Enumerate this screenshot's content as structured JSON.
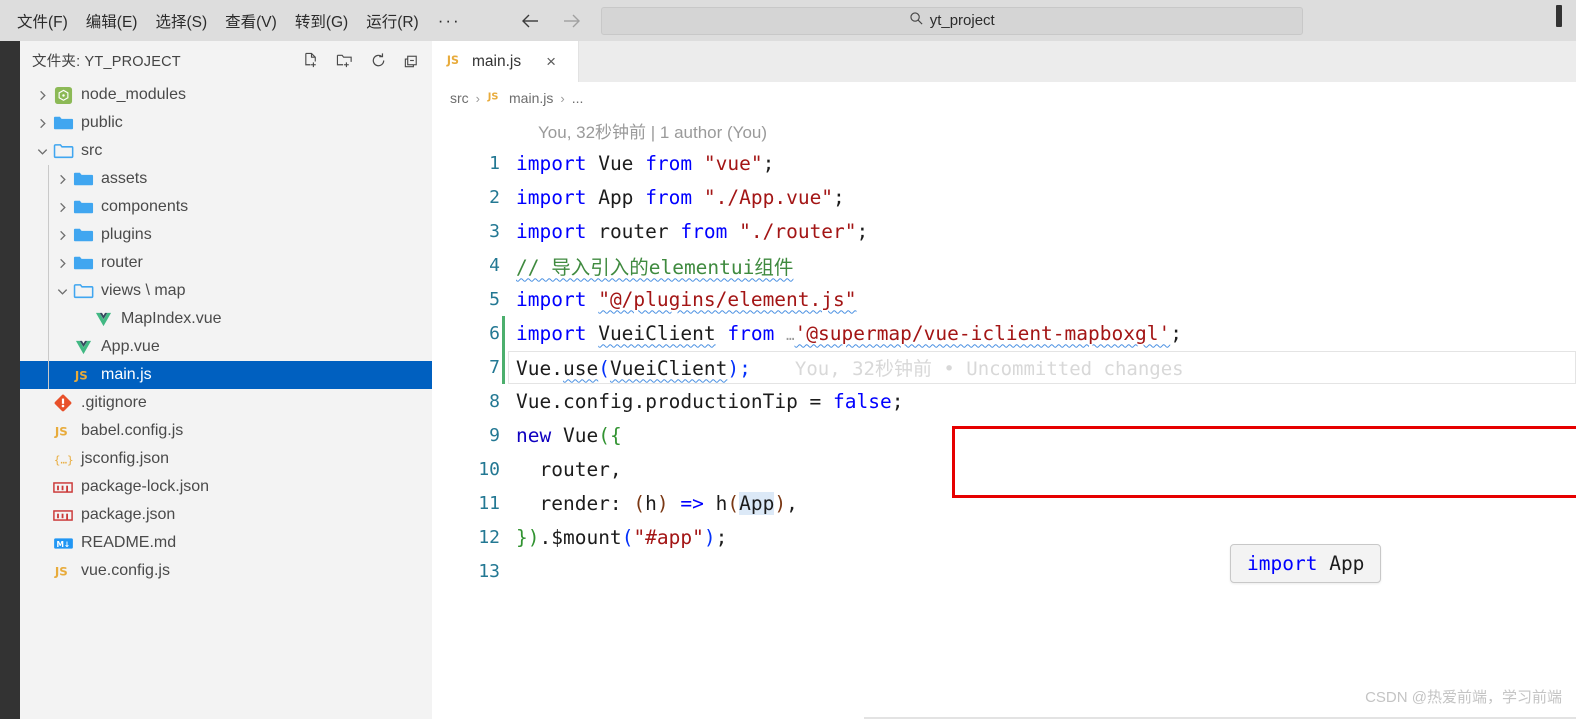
{
  "titlebar": {
    "menus": [
      "文件(F)",
      "编辑(E)",
      "选择(S)",
      "查看(V)",
      "转到(G)",
      "运行(R)"
    ],
    "more": "···",
    "back_icon": "arrow-left-icon",
    "forward_icon": "arrow-right-icon",
    "search_icon": "search-icon",
    "search_value": "yt_project"
  },
  "sidebar": {
    "header_title": "文件夹: YT_PROJECT",
    "actions": [
      {
        "name": "new-file-icon",
        "title": "新建文件"
      },
      {
        "name": "new-folder-icon",
        "title": "新建文件夹"
      },
      {
        "name": "refresh-icon",
        "title": "刷新"
      },
      {
        "name": "collapse-all-icon",
        "title": "全部折叠"
      }
    ],
    "tree": [
      {
        "label": "node_modules",
        "icon": "node-icon",
        "type": "folder",
        "depth": 0,
        "state": "collapsed",
        "selected": false
      },
      {
        "label": "public",
        "icon": "folder-icon",
        "type": "folder",
        "depth": 0,
        "state": "collapsed",
        "selected": false
      },
      {
        "label": "src",
        "icon": "folder-open-icon",
        "type": "folder",
        "depth": 0,
        "state": "expanded",
        "selected": false
      },
      {
        "label": "assets",
        "icon": "folder-icon",
        "type": "folder",
        "depth": 1,
        "state": "collapsed",
        "selected": false
      },
      {
        "label": "components",
        "icon": "folder-icon",
        "type": "folder",
        "depth": 1,
        "state": "collapsed",
        "selected": false
      },
      {
        "label": "plugins",
        "icon": "folder-icon",
        "type": "folder",
        "depth": 1,
        "state": "collapsed",
        "selected": false
      },
      {
        "label": "router",
        "icon": "folder-icon",
        "type": "folder",
        "depth": 1,
        "state": "collapsed",
        "selected": false
      },
      {
        "label": "views \\ map",
        "icon": "folder-open-icon",
        "type": "folder",
        "depth": 1,
        "state": "expanded",
        "selected": false
      },
      {
        "label": "MapIndex.vue",
        "icon": "vue-icon",
        "type": "file",
        "depth": 2,
        "state": "none",
        "selected": false
      },
      {
        "label": "App.vue",
        "icon": "vue-icon",
        "type": "file",
        "depth": 1,
        "state": "none",
        "selected": false
      },
      {
        "label": "main.js",
        "icon": "js-icon",
        "type": "file",
        "depth": 1,
        "state": "none",
        "selected": true
      },
      {
        "label": ".gitignore",
        "icon": "git-icon",
        "type": "file",
        "depth": 0,
        "state": "none",
        "selected": false
      },
      {
        "label": "babel.config.js",
        "icon": "js-icon",
        "type": "file",
        "depth": 0,
        "state": "none",
        "selected": false
      },
      {
        "label": "jsconfig.json",
        "icon": "json-icon",
        "type": "file",
        "depth": 0,
        "state": "none",
        "selected": false
      },
      {
        "label": "package-lock.json",
        "icon": "npm-icon",
        "type": "file",
        "depth": 0,
        "state": "none",
        "selected": false
      },
      {
        "label": "package.json",
        "icon": "npm-icon",
        "type": "file",
        "depth": 0,
        "state": "none",
        "selected": false
      },
      {
        "label": "README.md",
        "icon": "markdown-icon",
        "type": "file",
        "depth": 0,
        "state": "none",
        "selected": false
      },
      {
        "label": "vue.config.js",
        "icon": "js-icon",
        "type": "file",
        "depth": 0,
        "state": "none",
        "selected": false
      }
    ]
  },
  "editor": {
    "tab": {
      "icon": "js-icon",
      "name": "main.js",
      "close": "×"
    },
    "breadcrumb": [
      "src",
      "main.js",
      "..."
    ],
    "breadcrumb_sep": "›",
    "blame_header": "You, 32秒钟前 | 1 author (You)",
    "inline_blame": "You, 32秒钟前 • Uncommitted changes",
    "tooltip": {
      "keyword": "import",
      "name": "App"
    },
    "line_numbers": [
      "1",
      "2",
      "3",
      "4",
      "5",
      "6",
      "7",
      "8",
      "9",
      "10",
      "11",
      "12",
      "13"
    ],
    "code_lines": [
      "import Vue from \"vue\";",
      "import App from \"./App.vue\";",
      "import router from \"./router\";",
      "// 导入引入的elementui组件",
      "import \"@/plugins/element.js\"",
      "import VueiClient from '@supermap/vue-iclient-mapboxgl';",
      "Vue.use(VueiClient);",
      "Vue.config.productionTip = false;",
      "new Vue({",
      "  router,",
      "  render: (h) => h(App),",
      "}).$mount(\"#app\");",
      ""
    ],
    "tokens": {
      "l1": {
        "kw1": "import",
        "name": "Vue",
        "kw2": "from",
        "str": "\"vue\"",
        "semi": ";"
      },
      "l2": {
        "kw1": "import",
        "name": "App",
        "kw2": "from",
        "str": "\"./App.vue\"",
        "semi": ";"
      },
      "l3": {
        "kw1": "import",
        "name": "router",
        "kw2": "from",
        "str": "\"./router\"",
        "semi": ";"
      },
      "l4": {
        "comment": "// 导入引入的elementui组件"
      },
      "l5": {
        "kw1": "import",
        "str": "\"@/plugins/element.js\""
      },
      "l6": {
        "kw1": "import",
        "name": "VueiClient",
        "kw2": "from",
        "str": "'@supermap/vue-iclient-mapboxgl'",
        "semi": ";"
      },
      "l7": {
        "obj": "Vue",
        "dot1": ".",
        "method": "use",
        "open": "(",
        "arg": "VueiClient",
        "close": ")",
        "semi": ";"
      },
      "l8": {
        "obj": "Vue",
        "dot1": ".",
        "prop1": "config",
        "dot2": ".",
        "prop2": "productionTip",
        "eq": " = ",
        "val": "false",
        "semi": ";"
      },
      "l9": {
        "kw": "new",
        "name": "Vue",
        "open": "({"
      },
      "l10": {
        "prop": "  router,"
      },
      "l11": {
        "key": "  render",
        "colon": ": ",
        "p1": "(",
        "param": "h",
        "p2": ")",
        "arrow": " => ",
        "fn": "h",
        "p3": "(",
        "arg": "App",
        "p4": ")",
        "comma": ","
      },
      "l12": {
        "close": "})",
        "dot": ".",
        "method": "$mount",
        "p1": "(",
        "str": "\"#app\"",
        "p2": ")",
        "semi": ";"
      }
    },
    "annotation_box_color": "#e60000",
    "modified_gutter_color": "#4caf6d"
  },
  "watermark": "CSDN @热爱前端，学习前端",
  "colors": {
    "titlebar_bg": "#dddddd",
    "sidebar_bg": "#f3f3f3",
    "activity_bg": "#333333",
    "editor_bg": "#ffffff",
    "selection_blue": "#0060c0",
    "keyword_blue": "#0000ff",
    "string_red": "#a31515",
    "comment_green": "#3f8a3f",
    "linenum_teal": "#237893"
  }
}
